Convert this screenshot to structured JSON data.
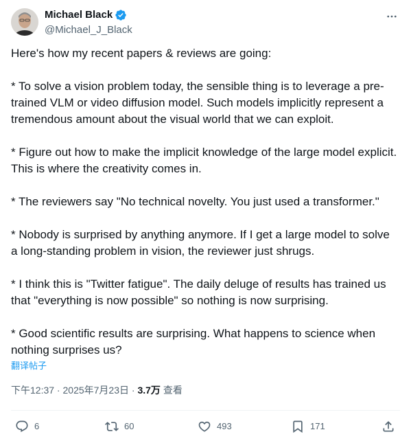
{
  "author": {
    "display_name": "Michael Black",
    "handle": "@Michael_J_Black",
    "verified": true
  },
  "tweet": {
    "paragraphs": [
      "Here's how my recent papers & reviews are going:",
      "* To solve a vision problem today, the sensible thing is to leverage a pre-trained VLM or video diffusion model. Such models implicitly represent a tremendous amount about the visual world that we can exploit.",
      "* Figure out how to make the implicit knowledge of the large model explicit. This is where the creativity comes in.",
      "* The reviewers say \"No technical novelty. You just used a transformer.\"",
      "* Nobody is surprised by anything anymore. If I get a large model to solve a long-standing problem in vision, the reviewer just shrugs.",
      "* I think this is \"Twitter fatigue\". The daily deluge of results has trained us that \"everything is now possible\" so nothing is now surprising.",
      "* Good scientific results are surprising. What happens to science when nothing surprises us?"
    ],
    "translate_label": "翻译帖子"
  },
  "meta": {
    "time": "下午12:37",
    "separator": " · ",
    "date": "2025年7月23日",
    "views_count": "3.7万",
    "views_label": "查看"
  },
  "actions": {
    "replies": "6",
    "retweets": "60",
    "likes": "493",
    "bookmarks": "171"
  },
  "colors": {
    "text": "#0f1419",
    "secondary": "#536471",
    "accent": "#1d9bf0",
    "divider": "#eff3f4"
  },
  "icons": {
    "verified": "verified-badge-icon",
    "more": "more-horizontal-icon",
    "reply": "reply-bubble-icon",
    "retweet": "retweet-icon",
    "like": "heart-icon",
    "bookmark": "bookmark-icon",
    "share": "share-upload-icon"
  }
}
